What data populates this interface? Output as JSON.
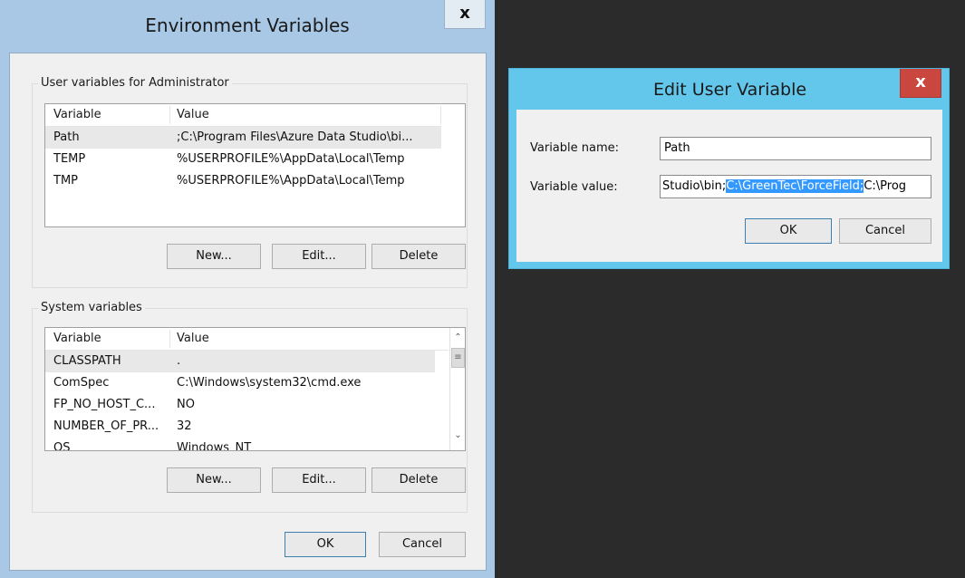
{
  "env_window": {
    "title": "Environment Variables",
    "close_glyph": "x",
    "user_group": {
      "label": "User variables for Administrator",
      "columns": [
        "Variable",
        "Value"
      ],
      "rows": [
        {
          "variable": "Path",
          "value": ";C:\\Program Files\\Azure Data Studio\\bi..."
        },
        {
          "variable": "TEMP",
          "value": "%USERPROFILE%\\AppData\\Local\\Temp"
        },
        {
          "variable": "TMP",
          "value": "%USERPROFILE%\\AppData\\Local\\Temp"
        }
      ],
      "buttons": {
        "new": "New...",
        "edit": "Edit...",
        "delete": "Delete"
      }
    },
    "system_group": {
      "label": "System variables",
      "columns": [
        "Variable",
        "Value"
      ],
      "rows": [
        {
          "variable": "CLASSPATH",
          "value": "."
        },
        {
          "variable": "ComSpec",
          "value": "C:\\Windows\\system32\\cmd.exe"
        },
        {
          "variable": "FP_NO_HOST_C...",
          "value": "NO"
        },
        {
          "variable": "NUMBER_OF_PR...",
          "value": "32"
        },
        {
          "variable": "OS",
          "value": "Windows_NT"
        }
      ],
      "buttons": {
        "new": "New...",
        "edit": "Edit...",
        "delete": "Delete"
      },
      "scroll_icons": {
        "up": "chevron-up-icon",
        "thumb": "scroll-grip-icon",
        "down": "chevron-down-icon"
      }
    },
    "ok": "OK",
    "cancel": "Cancel"
  },
  "edit_dialog": {
    "title": "Edit User Variable",
    "close_glyph": "x",
    "name_label": "Variable name:",
    "name_value": "Path",
    "value_label": "Variable value:",
    "value_before": "Studio\\bin;",
    "value_selected": "C:\\GreenTec\\ForceField;",
    "value_after": "C:\\Prog",
    "ok": "OK",
    "cancel": "Cancel"
  },
  "colors": {
    "env_frame": "#a8c8e6",
    "edit_frame": "#62c7ea",
    "close_red": "#c9473f",
    "selection": "#3399ff",
    "desktop": "#2b2b2b"
  }
}
